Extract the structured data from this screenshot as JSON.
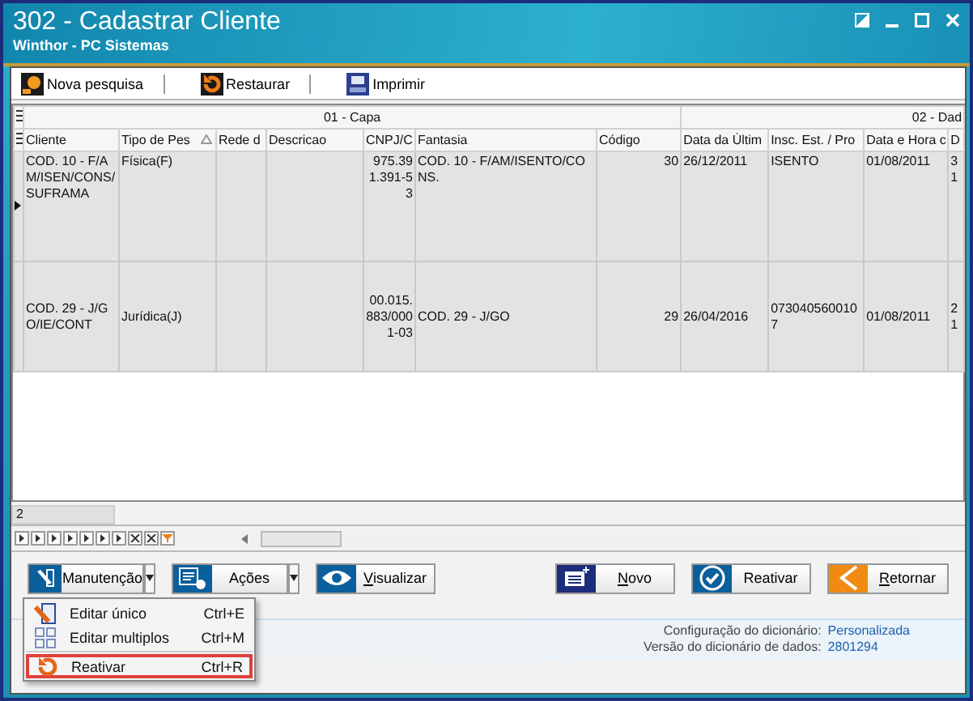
{
  "window": {
    "title": "302 - Cadastrar Cliente",
    "subtitle": "Winthor - PC Sistemas"
  },
  "toolbar": [
    {
      "label": "Nova pesquisa",
      "kind": "search"
    },
    {
      "label": "Restaurar",
      "kind": "restore"
    },
    {
      "label": "Imprimir",
      "kind": "print"
    }
  ],
  "grid": {
    "bands": [
      "01 - Capa",
      "02 - Dad"
    ],
    "columns": [
      {
        "label": "Cliente",
        "sorted": false
      },
      {
        "label": "Tipo de Pes",
        "sorted": true
      },
      {
        "label": "Rede d",
        "sorted": false
      },
      {
        "label": "Descricao",
        "sorted": false
      },
      {
        "label": "CNPJ/C",
        "sorted": false
      },
      {
        "label": "Fantasia",
        "sorted": false
      },
      {
        "label": "Código",
        "sorted": false
      },
      {
        "label": "Data da Últim",
        "sorted": false
      },
      {
        "label": "Insc. Est. / Pro",
        "sorted": false
      },
      {
        "label": "Data e Hora c",
        "sorted": false
      },
      {
        "label": "D",
        "sorted": false
      }
    ],
    "rows": [
      {
        "selected": true,
        "cells": [
          "COD. 10 - F/AM/ISEN/CONS/SUFRAMA",
          "Física(F)",
          "",
          "",
          "975.391.391-53",
          "COD. 10 - F/AM/ISENTO/CONS.",
          "30",
          "26/12/2011",
          "ISENTO",
          "01/08/2011",
          "3 1"
        ]
      },
      {
        "selected": false,
        "cells": [
          "COD. 29 - J/GO/IE/CONT",
          "Jurídica(J)",
          "",
          "",
          "00.015.883/0001-03",
          "COD. 29 - J/GO",
          "29",
          "26/04/2016",
          "0730405600107",
          "01/08/2011",
          "2 1"
        ]
      }
    ],
    "record_count": "2"
  },
  "buttons": [
    {
      "label": "Manutenção",
      "kind": "maintenance",
      "dropdown": true,
      "mnemonic": false
    },
    {
      "label": "Ações",
      "kind": "actions",
      "dropdown": true,
      "mnemonic": false
    },
    {
      "label": "Visualizar",
      "kind": "view",
      "dropdown": false,
      "mnemonic": true
    },
    {
      "label": "Novo",
      "kind": "new",
      "dropdown": false,
      "mnemonic": true
    },
    {
      "label": "Reativar",
      "kind": "reactivate",
      "dropdown": false,
      "mnemonic": false
    },
    {
      "label": "Retornar",
      "kind": "return",
      "dropdown": false,
      "mnemonic": true
    }
  ],
  "menu": [
    {
      "label": "Editar único",
      "shortcut": "Ctrl+E",
      "kind": "edit",
      "separator_before": false,
      "highlighted": false
    },
    {
      "label": "Editar multiplos",
      "shortcut": "Ctrl+M",
      "kind": "multi",
      "separator_before": false,
      "highlighted": false
    },
    {
      "label": "Reativar",
      "shortcut": "Ctrl+R",
      "kind": "reactivate",
      "separator_before": true,
      "highlighted": true
    }
  ],
  "status": [
    {
      "label": "Configuração do dicionário:",
      "value": "Personalizada"
    },
    {
      "label": "Versão do dicionário de dados:",
      "value": "2801294"
    }
  ]
}
